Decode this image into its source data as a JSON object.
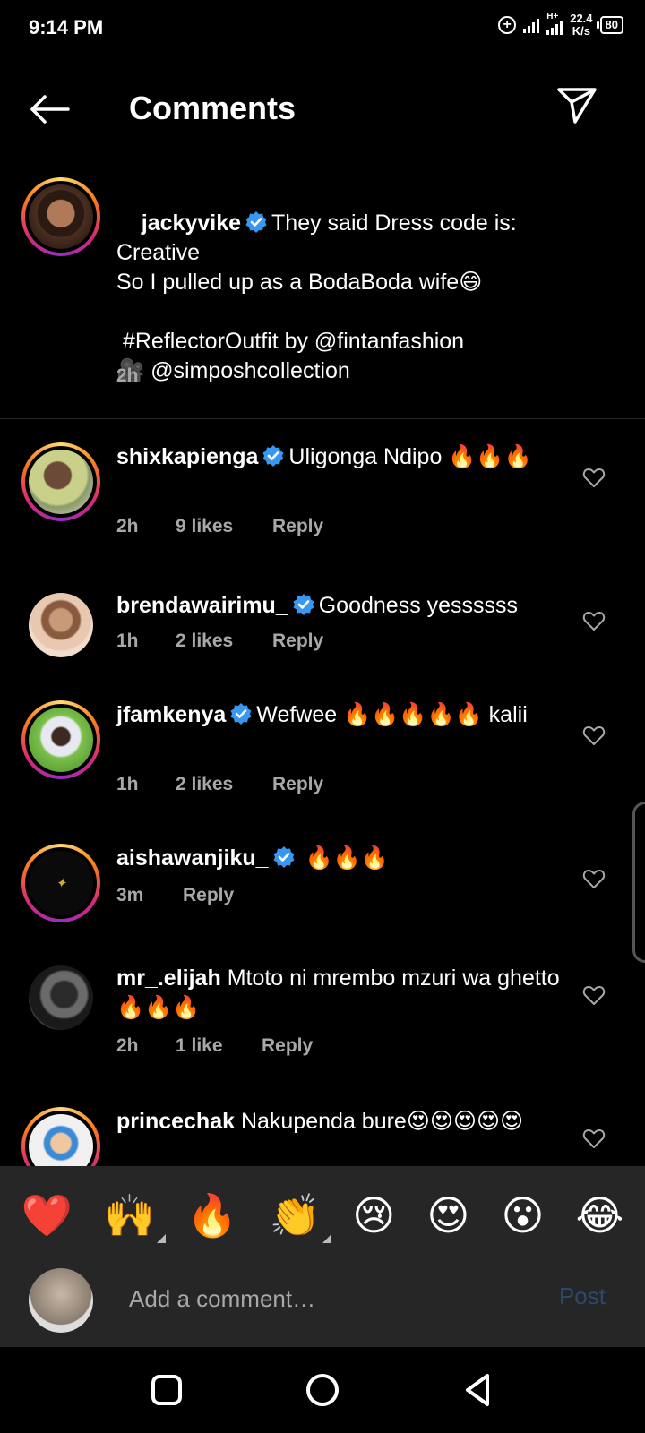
{
  "status_bar": {
    "time": "9:14 PM",
    "network_speed_value": "22.4",
    "network_speed_unit": "K/s",
    "network_type": "H+",
    "battery": "80"
  },
  "header": {
    "title": "Comments"
  },
  "caption": {
    "username": "jackyvike",
    "verified": true,
    "text": "They said Dress code is:\nCreative\nSo I pulled up as a BodaBoda wife😄\n\n #ReflectorOutfit by @fintanfashion\n🎥 @simposhcollection",
    "time": "2h"
  },
  "comments": [
    {
      "username": "shixkapienga",
      "verified": true,
      "text": "Uligonga Ndipo 🔥🔥🔥",
      "time": "2h",
      "likes": "9 likes",
      "reply": "Reply"
    },
    {
      "username": "brendawairimu_",
      "verified": true,
      "text": "Goodness yessssss",
      "time": "1h",
      "likes": "2 likes",
      "reply": "Reply"
    },
    {
      "username": "jfamkenya",
      "verified": true,
      "text": "Wefwee 🔥🔥🔥🔥🔥 kalii",
      "time": "1h",
      "likes": "2 likes",
      "reply": "Reply"
    },
    {
      "username": "aishawanjiku_",
      "verified": true,
      "text": "🔥🔥🔥",
      "time": "3m",
      "likes": "",
      "reply": "Reply"
    },
    {
      "username": "mr_.elijah",
      "verified": false,
      "text": "Mtoto ni mrembo mzuri wa ghetto🔥🔥🔥",
      "time": "2h",
      "likes": "1 like",
      "reply": "Reply"
    },
    {
      "username": "princechak",
      "verified": false,
      "text": "Nakupenda bure😍😍😍😍😍",
      "time": "",
      "likes": "",
      "reply": ""
    }
  ],
  "reactions": [
    "❤️",
    "🙌",
    "🔥",
    "👏",
    "😢",
    "😍",
    "😮",
    "😂"
  ],
  "comment_input": {
    "placeholder": "Add a comment…",
    "post_label": "Post"
  },
  "colors": {
    "background": "#000000",
    "secondary_text": "#a8a8a8",
    "verified_blue": "#3897f0",
    "post_disabled": "#2b4a6b",
    "panel": "#262626"
  }
}
